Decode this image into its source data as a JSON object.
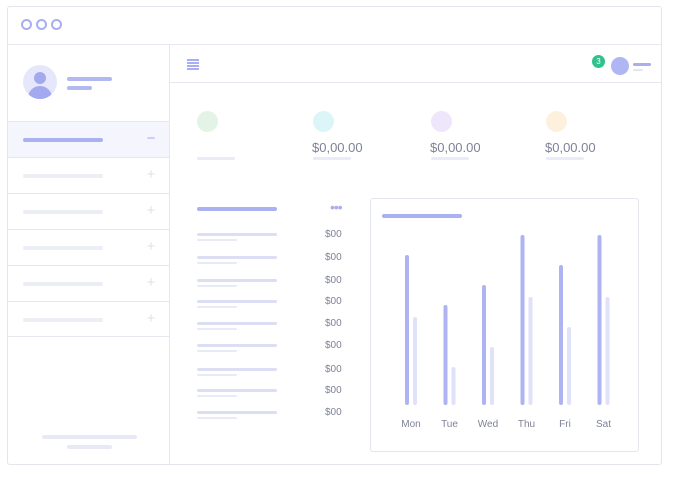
{
  "window": {
    "controls": [
      "close",
      "minimize",
      "maximize"
    ]
  },
  "header": {
    "menu_icon": "hamburger-icon",
    "notification_count": "3",
    "user_avatar": "avatar"
  },
  "sidebar": {
    "profile": {
      "avatar_icon": "user-avatar-icon"
    },
    "items": [
      {
        "state": "expanded",
        "toggle": "−"
      },
      {
        "state": "collapsed",
        "toggle": "+"
      },
      {
        "state": "collapsed",
        "toggle": "+"
      },
      {
        "state": "collapsed",
        "toggle": "+"
      },
      {
        "state": "collapsed",
        "toggle": "+"
      },
      {
        "state": "collapsed",
        "toggle": "+"
      }
    ]
  },
  "stats": [
    {
      "color": "#e3f3e6",
      "value": ""
    },
    {
      "color": "#dcf5f8",
      "value": "$0,00.00"
    },
    {
      "color": "#eee6fb",
      "value": "$0,00.00"
    },
    {
      "color": "#fdf1dd",
      "value": "$0,00.00"
    }
  ],
  "list": {
    "more_icon": "more-horizontal-icon",
    "rows": [
      {
        "amount": "$00"
      },
      {
        "amount": "$00"
      },
      {
        "amount": "$00"
      },
      {
        "amount": "$00"
      },
      {
        "amount": "$00"
      },
      {
        "amount": "$00"
      },
      {
        "amount": "$00"
      },
      {
        "amount": "$00"
      },
      {
        "amount": "$00"
      }
    ]
  },
  "chart_data": {
    "type": "bar",
    "categories": [
      "Mon",
      "Tue",
      "Wed",
      "Thu",
      "Fri",
      "Sat"
    ],
    "series": [
      {
        "values": [
          150,
          100,
          120,
          170,
          140,
          170
        ],
        "color": "#aeb4f1"
      },
      {
        "values": [
          88,
          38,
          58,
          108,
          78,
          108
        ],
        "color": "#dfe2f8"
      }
    ],
    "ylim": [
      0,
      170
    ],
    "grid": false
  }
}
